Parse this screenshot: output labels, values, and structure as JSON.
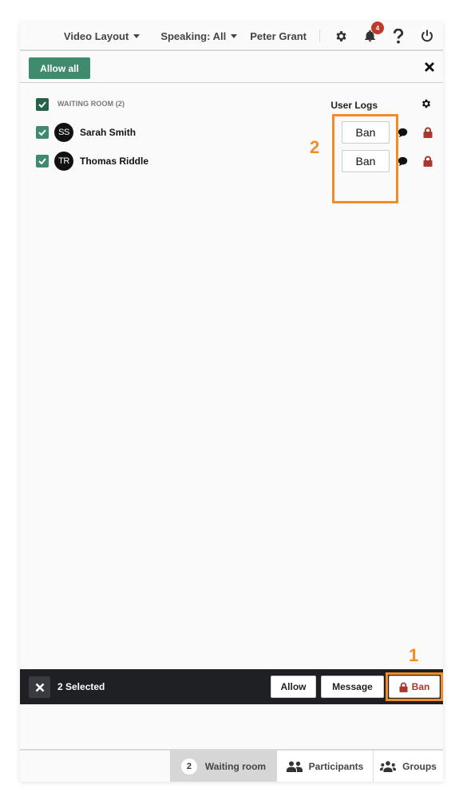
{
  "topbar": {
    "video_layout": "Video Layout",
    "speaking": "Speaking: All",
    "user_name": "Peter Grant",
    "notification_count": "4"
  },
  "actions": {
    "allow_all": "Allow all"
  },
  "waiting_room": {
    "title": "WAITING ROOM (2)",
    "user_logs": "User Logs",
    "users": [
      {
        "initials": "SS",
        "name": "Sarah Smith",
        "ban_label": "Ban",
        "selected": true
      },
      {
        "initials": "TR",
        "name": "Thomas Riddle",
        "ban_label": "Ban",
        "selected": true
      }
    ]
  },
  "selection_bar": {
    "count_label": "2 Selected",
    "allow": "Allow",
    "message": "Message",
    "ban": "Ban"
  },
  "callouts": {
    "first": "1",
    "second": "2"
  },
  "tabs": [
    {
      "label": "Waiting room",
      "count": "2",
      "active": true
    },
    {
      "label": "Participants",
      "active": false
    },
    {
      "label": "Groups",
      "active": false
    }
  ],
  "colors": {
    "accent_green": "#3f8b6e",
    "ban_red": "#a8382c",
    "callout_orange": "#f28c28",
    "selection_bar": "#1f2023"
  }
}
